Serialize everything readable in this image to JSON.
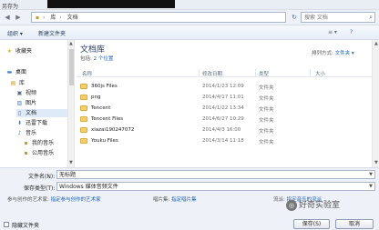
{
  "window": {
    "title": "另存为"
  },
  "address": {
    "crumbs": [
      "库",
      "文档"
    ],
    "search_placeholder": "搜索 文档"
  },
  "toolbar": {
    "organize": "组织 ▾",
    "new_folder": "新建文件夹",
    "view": "≡ ▾"
  },
  "sidebar": {
    "items": [
      {
        "label": "收藏夹",
        "icon": "star-icon"
      },
      {
        "label": "桌面",
        "icon": "desktop-icon"
      },
      {
        "label": "库",
        "icon": "library-icon"
      },
      {
        "label": "视频",
        "icon": "video-icon"
      },
      {
        "label": "图片",
        "icon": "picture-icon"
      },
      {
        "label": "文档",
        "icon": "document-icon"
      },
      {
        "label": "迅雷下载",
        "icon": "download-icon"
      },
      {
        "label": "音乐",
        "icon": "music-icon"
      },
      {
        "label": "我的音乐",
        "icon": "folder-icon"
      },
      {
        "label": "公用音乐",
        "icon": "folder-icon"
      }
    ]
  },
  "library": {
    "title": "文档库",
    "subtitle_prefix": "包括:",
    "subtitle_link": "2 个位置",
    "arrange_label": "排列方式:",
    "arrange_value": "文件夹 ▾"
  },
  "columns": {
    "name": "名称",
    "date": "修改日期",
    "type": "类型",
    "size": "大小"
  },
  "files": [
    {
      "name": "360js Files",
      "date": "2014/1/23 12:09",
      "type": "文件夹"
    },
    {
      "name": "png",
      "date": "2014/4/17 11:01",
      "type": "文件夹"
    },
    {
      "name": "Tencent",
      "date": "2014/1/22 13:34",
      "type": "文件夹"
    },
    {
      "name": "Tencent Files",
      "date": "2014/6/27 10:29",
      "type": "文件夹"
    },
    {
      "name": "xiazai190247072",
      "date": "2014/4/3 16:00",
      "type": "文件夹"
    },
    {
      "name": "Youku Files",
      "date": "2014/3/14 11:18",
      "type": "文件夹"
    }
  ],
  "form": {
    "filename_label": "文件名(N):",
    "filename_value": "无标题",
    "savetype_label": "保存类型(T):",
    "savetype_value": "Windows 媒体音频文件",
    "artist_label": "参与创作的艺术家:",
    "artist_link": "指定参与创作的艺术家",
    "thumb_label": "唱片集:",
    "thumb_link": "指定唱片集",
    "genre_label": "流派:",
    "genre_link": "指定音乐的流派",
    "hide_folders": "隐藏文件夹",
    "save_button": "保存(S)",
    "cancel_button": "取消"
  },
  "watermark": {
    "text": "好奇实验室"
  }
}
